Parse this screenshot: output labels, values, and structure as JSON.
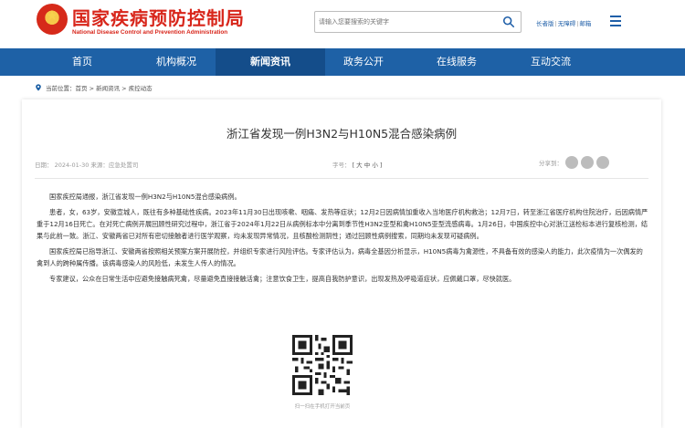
{
  "header": {
    "logo_cn": "国家疾病预防控制局",
    "logo_en": "National Disease Control and Prevention Administration",
    "search_placeholder": "请输入您要搜索的关键字",
    "links": [
      "长者版",
      "无障碍",
      "邮箱"
    ]
  },
  "nav": {
    "items": [
      {
        "label": "首页"
      },
      {
        "label": "机构概况"
      },
      {
        "label": "新闻资讯"
      },
      {
        "label": "政务公开"
      },
      {
        "label": "在线服务"
      },
      {
        "label": "互动交流"
      }
    ],
    "active_index": 2
  },
  "breadcrumb": {
    "prefix": "当前位置：",
    "path": "首页 > 新闻资讯 > 疾控动态"
  },
  "article": {
    "title": "浙江省发现一例H3N2与H10N5混合感染病例",
    "meta": "日期： 2024-01-30 来源：应急处置司",
    "font_label": "字号：",
    "font_sizes": "[ 大  中  小 ]",
    "share_label": "分享到：",
    "paragraphs": [
      "国家疾控局通报，浙江省发现一例H3N2与H10N5混合感染病例。",
      "患者，女，63岁，安徽宣城人，既往有多种基础性疾病。2023年11月30日出现咳嗽、咽痛、发热等症状；12月2日因病情加重收入当地医疗机构救治；12月7日，转至浙江省医疗机构住院治疗，后因病情严重于12月16日死亡。在对死亡病例开展回顾性研究过程中，浙江省于2024年1月22日从病例标本中分离到季节性H3N2亚型和禽H10N5亚型流感病毒。1月26日，中国疾控中心对浙江送检标本进行复核检测，结果与此前一致。浙江、安徽两省已对所有密切接触者进行医学观察，均未发现异常情况，且核酸检测阴性；通过回顾性病例搜索，同期均未发现可疑病例。",
      "国家疾控局已指导浙江、安徽两省按照相关预案方案开展防控，并组织专家进行风险评估。专家评估认为，病毒全基因分析显示，H10N5病毒为禽源性，不具备有效的感染人的能力，此次疫情为一次偶发的禽到人的跨种属传播。该病毒感染人的风险低，未发生人传人的情况。",
      "专家建议，公众在日常生活中应避免接触病死禽，尽量避免直接接触活禽；注意饮食卫生，提高自我防护意识，出现发热及呼吸道症状，应佩戴口罩，尽快就医。"
    ],
    "qr_caption": "扫一扫在手机打开当前页"
  },
  "colors": {
    "brand_red": "#d8261b",
    "nav_blue": "#1e61a6",
    "nav_active": "#144d8a"
  }
}
